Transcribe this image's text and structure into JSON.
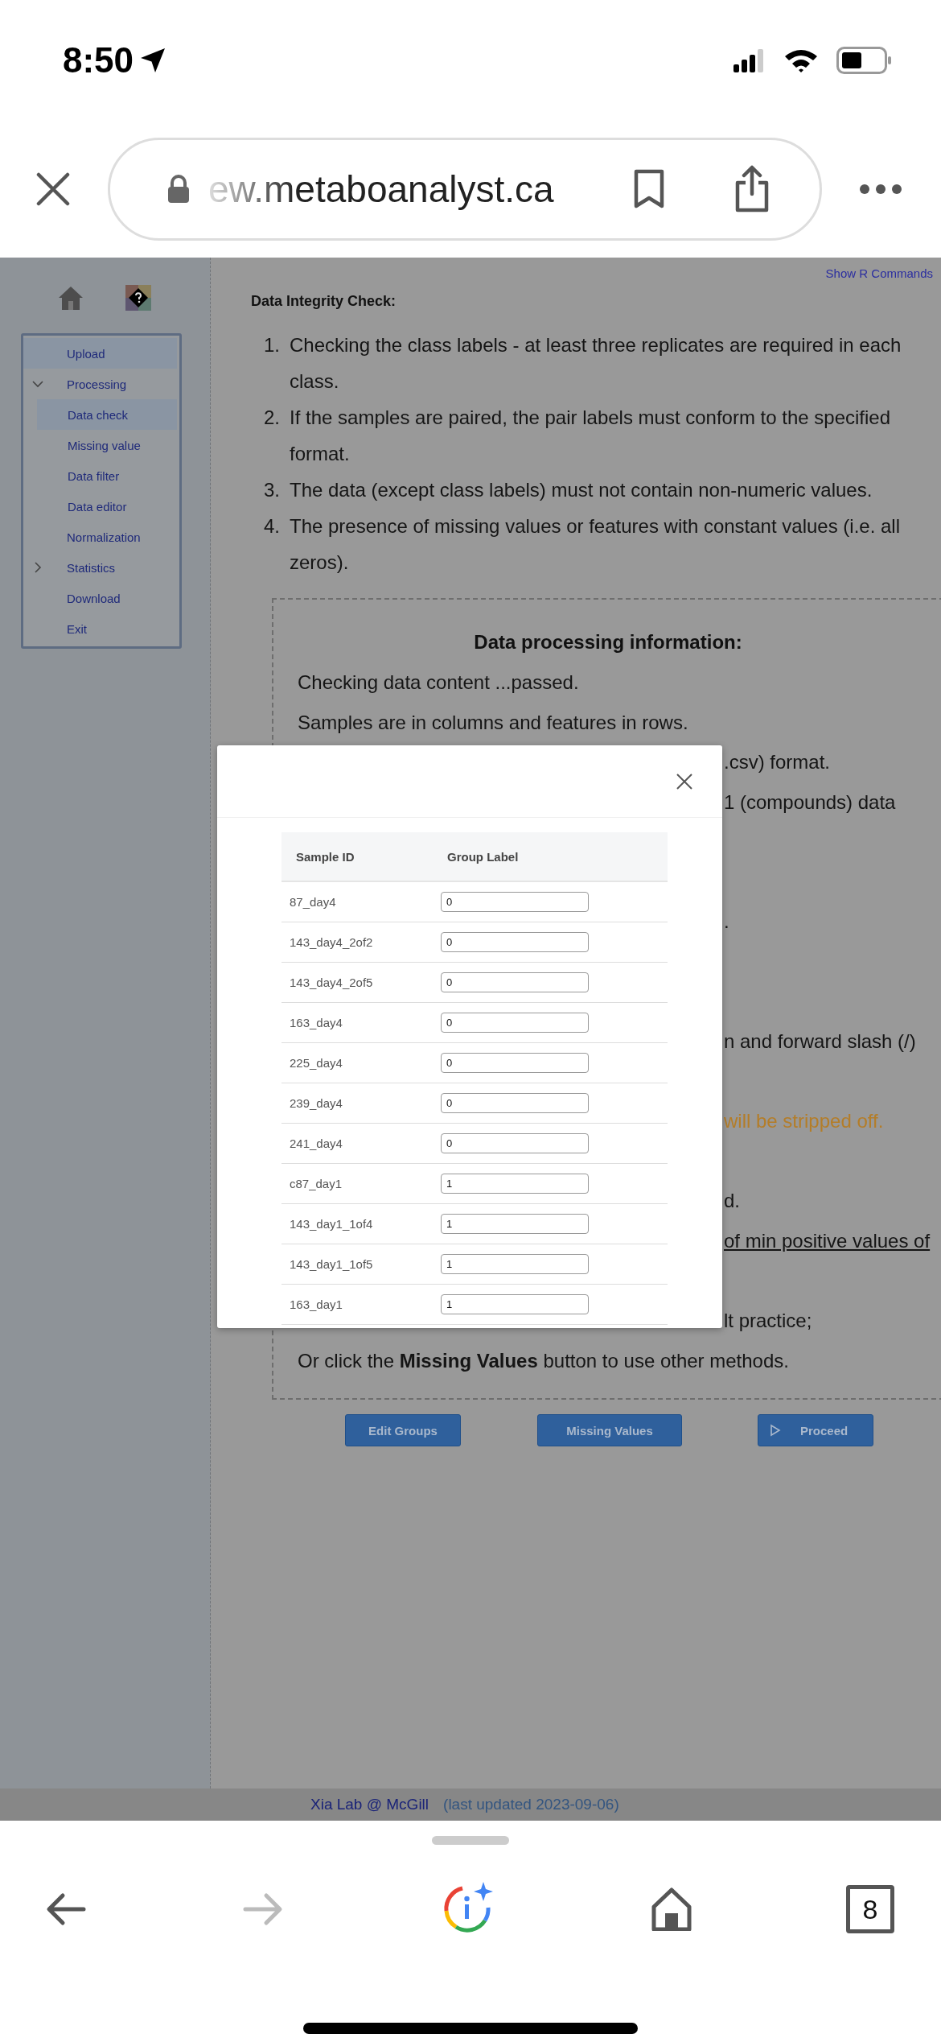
{
  "status_bar": {
    "time": "8:50"
  },
  "browser": {
    "url": "ew.metaboanalyst.ca",
    "tab_count": "8"
  },
  "sidebar": {
    "items": [
      {
        "kind": "link",
        "label": "Upload",
        "selected": true
      },
      {
        "kind": "group",
        "label": "Processing",
        "expanded": true,
        "selected": false,
        "children": [
          {
            "label": "Data check",
            "selected": true
          },
          {
            "label": "Missing value",
            "selected": false
          },
          {
            "label": "Data filter",
            "selected": false
          },
          {
            "label": "Data editor",
            "selected": false
          }
        ]
      },
      {
        "kind": "link",
        "label": "Normalization",
        "selected": false
      },
      {
        "kind": "group",
        "label": "Statistics",
        "expanded": false,
        "selected": false
      },
      {
        "kind": "link",
        "label": "Download",
        "selected": false
      },
      {
        "kind": "link",
        "label": "Exit",
        "selected": false
      }
    ]
  },
  "main": {
    "show_r_commands": "Show R Commands",
    "integrity": {
      "title": "Data Integrity Check:",
      "items": [
        {
          "marker": "1.",
          "text": "Checking the class labels - at least three replicates are required in each class."
        },
        {
          "marker": "2.",
          "text": "If the samples are paired, the pair labels must conform to the specified format."
        },
        {
          "marker": "3.",
          "text": "The data (except class labels) must not contain non-numeric values."
        },
        {
          "marker": "4.",
          "text": "The presence of missing values or features with constant values (i.e. all zeros)."
        }
      ]
    },
    "processing": {
      "title": "Data processing information:",
      "lines": [
        {
          "kind": "full",
          "text": "Checking data content ...passed."
        },
        {
          "kind": "full",
          "text": "Samples are in columns and features in rows."
        },
        {
          "kind": "clipped",
          "text": ".csv) format."
        },
        {
          "kind": "clipped",
          "text": "1 (compounds) data"
        },
        {
          "kind": "clipped",
          "text": "."
        },
        {
          "kind": "clipped",
          "text": "n and forward slash (/)"
        },
        {
          "kind": "clipped",
          "text": "will be stripped off.",
          "warning": true
        },
        {
          "kind": "clipped",
          "text": "d."
        },
        {
          "kind": "clipped",
          "text": "of min positive values of",
          "underlined": true
        },
        {
          "kind": "clipped",
          "text": "lt practice;"
        },
        {
          "kind": "full",
          "text": "Or click the **Missing Values** button to use other methods."
        }
      ]
    },
    "buttons": [
      {
        "kind": "plain",
        "label": "Edit Groups"
      },
      {
        "kind": "plain",
        "label": "Missing Values"
      },
      {
        "kind": "play",
        "label": "Proceed"
      }
    ]
  },
  "footer": {
    "lab": "Xia Lab @ McGill",
    "updated": "(last updated 2023-09-06)"
  },
  "modal": {
    "columns": [
      "Sample ID",
      "Group Label"
    ],
    "rows": [
      {
        "sample_id": "87_day4",
        "group_label": "0"
      },
      {
        "sample_id": "143_day4_2of2",
        "group_label": "0"
      },
      {
        "sample_id": "143_day4_2of5",
        "group_label": "0"
      },
      {
        "sample_id": "163_day4",
        "group_label": "0"
      },
      {
        "sample_id": "225_day4",
        "group_label": "0"
      },
      {
        "sample_id": "239_day4",
        "group_label": "0"
      },
      {
        "sample_id": "241_day4",
        "group_label": "0"
      },
      {
        "sample_id": "c87_day1",
        "group_label": "1"
      },
      {
        "sample_id": "143_day1_1of4",
        "group_label": "1"
      },
      {
        "sample_id": "143_day1_1of5",
        "group_label": "1"
      },
      {
        "sample_id": "163_day1",
        "group_label": "1"
      }
    ]
  }
}
